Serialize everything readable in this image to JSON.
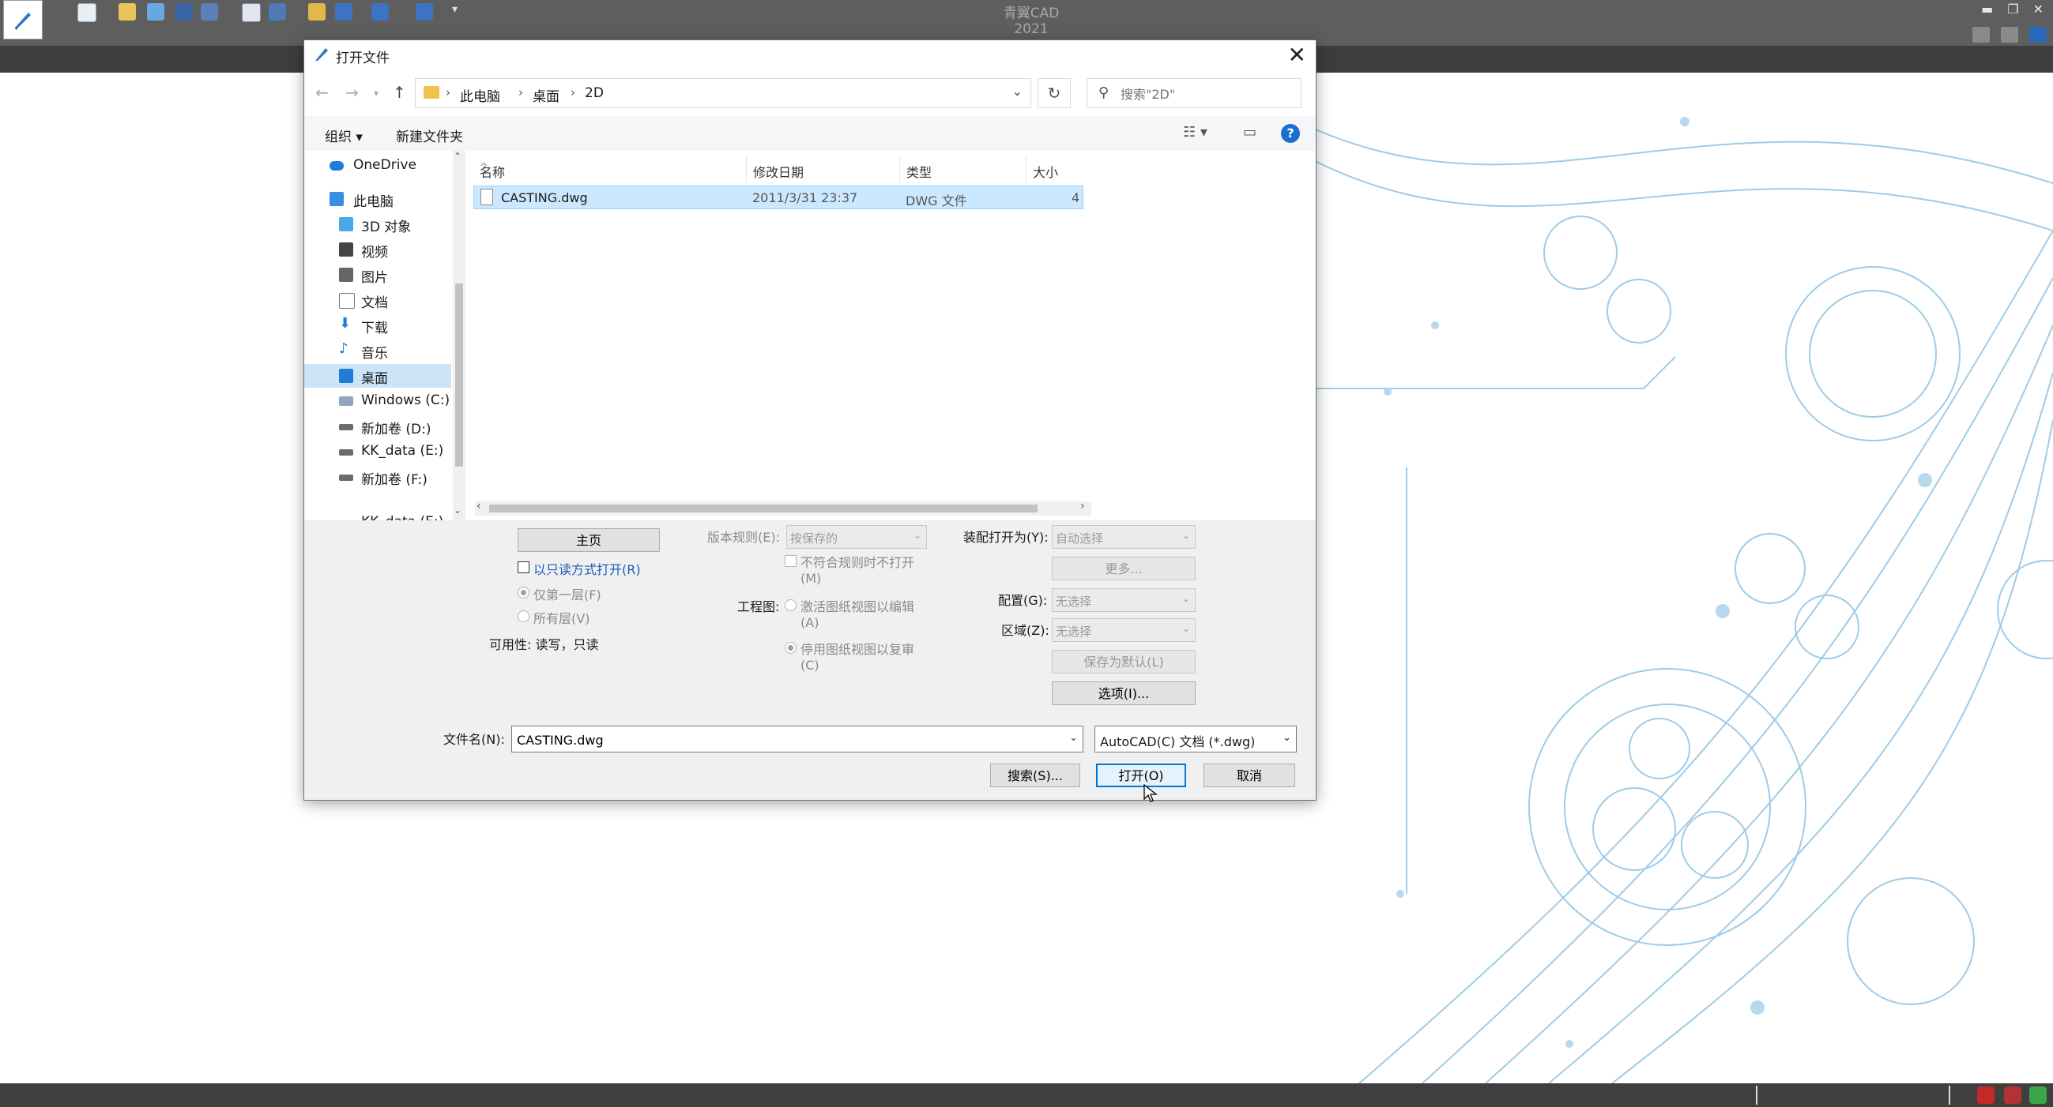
{
  "app": {
    "title": "青翼CAD 2021"
  },
  "dialog": {
    "title": "打开文件",
    "address": {
      "crumbs": [
        "此电脑",
        "桌面",
        "2D"
      ]
    },
    "search": {
      "placeholder": "搜索\"2D\""
    },
    "commands": {
      "organize": "组织 ▾",
      "new_folder": "新建文件夹"
    },
    "nav": {
      "items": [
        {
          "label": "OneDrive",
          "icon": "cloud-icon",
          "color": "#1e7bd6"
        },
        {
          "label": "此电脑",
          "icon": "computer-icon",
          "color": "#3a8ee6"
        },
        {
          "label": "3D 对象",
          "icon": "cube-icon",
          "color": "#4aa8e8"
        },
        {
          "label": "视频",
          "icon": "video-icon",
          "color": "#444444"
        },
        {
          "label": "图片",
          "icon": "picture-icon",
          "color": "#555555"
        },
        {
          "label": "文档",
          "icon": "document-icon",
          "color": "#777777"
        },
        {
          "label": "下载",
          "icon": "download-icon",
          "color": "#1e7bd6"
        },
        {
          "label": "音乐",
          "icon": "music-icon",
          "color": "#1e7bd6"
        },
        {
          "label": "桌面",
          "icon": "desktop-icon",
          "color": "#1e7bd6"
        },
        {
          "label": "Windows (C:)",
          "icon": "drive-icon",
          "color": "#555555"
        },
        {
          "label": "新加卷 (D:)",
          "icon": "drive-icon",
          "color": "#555555"
        },
        {
          "label": "KK_data (E:)",
          "icon": "drive-icon",
          "color": "#555555"
        },
        {
          "label": "新加卷 (F:)",
          "icon": "drive-icon",
          "color": "#555555"
        },
        {
          "label": "KK_data (E:)",
          "icon": "drive-icon",
          "color": "#555555"
        }
      ],
      "selected": "桌面"
    },
    "columns": {
      "name": "名称",
      "date": "修改日期",
      "type": "类型",
      "size": "大小"
    },
    "files": [
      {
        "name": "CASTING.dwg",
        "date": "2011/3/31 23:37",
        "type": "DWG 文件",
        "size": "4"
      }
    ],
    "options": {
      "home_button": "主页",
      "readonly": "以只读方式打开(R)",
      "first_level": "仅第一层(F)",
      "all_levels": "所有层(V)",
      "availability": "可用性: 读写，只读",
      "version_rule_label": "版本规则(E):",
      "version_rule_value": "按保存的",
      "noncompliant": "不符合规则时不打开",
      "noncompliant_key": "(M)",
      "drawing_label": "工程图:",
      "activate_views": "激活图纸视图以编辑",
      "activate_key": "(A)",
      "disable_views": "停用图纸视图以复审",
      "disable_key": "(C)",
      "assembly_open_label": "装配打开为(Y):",
      "assembly_open_value": "自动选择",
      "more_button": "更多...",
      "config_label": "配置(G):",
      "config_value": "无选择",
      "region_label": "区域(Z):",
      "region_value": "无选择",
      "save_default_button": "保存为默认(L)",
      "options_button": "选项(I)..."
    },
    "filename_label": "文件名(N):",
    "filename_value": "CASTING.dwg",
    "filter_value": "AutoCAD(C) 文档 (*.dwg)",
    "buttons": {
      "search": "搜索(S)...",
      "open": "打开(O)",
      "cancel": "取消"
    }
  }
}
